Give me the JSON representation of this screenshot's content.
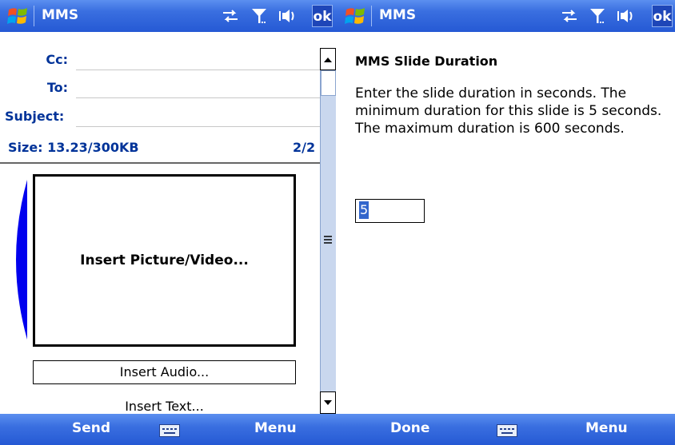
{
  "left": {
    "title": "MMS",
    "ok_label": "ok",
    "fields": {
      "cc_label": "Cc:",
      "to_label": "To:",
      "subject_label": "Subject:"
    },
    "size_text": "Size: 13.23/300KB",
    "slide_counter": "2/2",
    "insert_picture_label": "Insert Picture/Video...",
    "insert_audio_label": "Insert Audio...",
    "insert_text_label": "Insert Text...",
    "softkeys": {
      "left": "Send",
      "right": "Menu"
    }
  },
  "right": {
    "title": "MMS",
    "ok_label": "ok",
    "heading": "MMS Slide Duration",
    "description": "Enter the slide duration in seconds. The minimum duration for this slide is 5 seconds. The maximum duration is 600 seconds.",
    "duration_value": "5",
    "softkeys": {
      "left": "Done",
      "right": "Menu"
    }
  },
  "icons": {
    "start": "windows-start-icon",
    "connectivity": "connectivity-icon",
    "signal": "signal-icon",
    "volume": "volume-icon",
    "keyboard": "keyboard-icon"
  },
  "colors": {
    "titlebar": "#2559d4",
    "label_blue": "#003399",
    "scrollbar": "#c9d7ee",
    "selection": "#3366cc"
  }
}
